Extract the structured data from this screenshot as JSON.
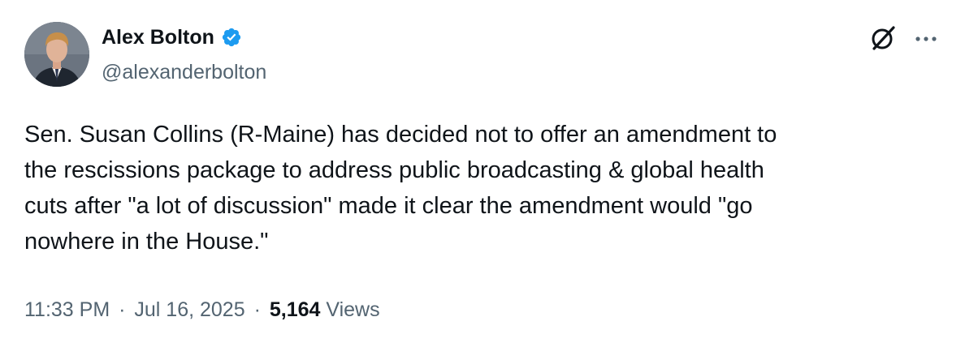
{
  "author": {
    "display_name": "Alex Bolton",
    "handle": "@alexanderbolton",
    "verified": true,
    "verified_color": "#1d9bf0"
  },
  "icons": {
    "avatar": "profile-photo",
    "verified": "verified-badge-icon",
    "grok": "grok-icon",
    "more": "more-options-icon"
  },
  "tweet": {
    "lines": [
      "Sen. Susan Collins (R-Maine) has decided not to offer an amendment to",
      "the rescissions package to address public broadcasting & global health",
      "cuts after \"a lot of discussion\" made it clear the amendment would \"go",
      "nowhere in the House.\""
    ]
  },
  "meta": {
    "time": "11:33 PM",
    "separator": "·",
    "date": "Jul 16, 2025",
    "views_count": "5,164",
    "views_label": "Views"
  }
}
